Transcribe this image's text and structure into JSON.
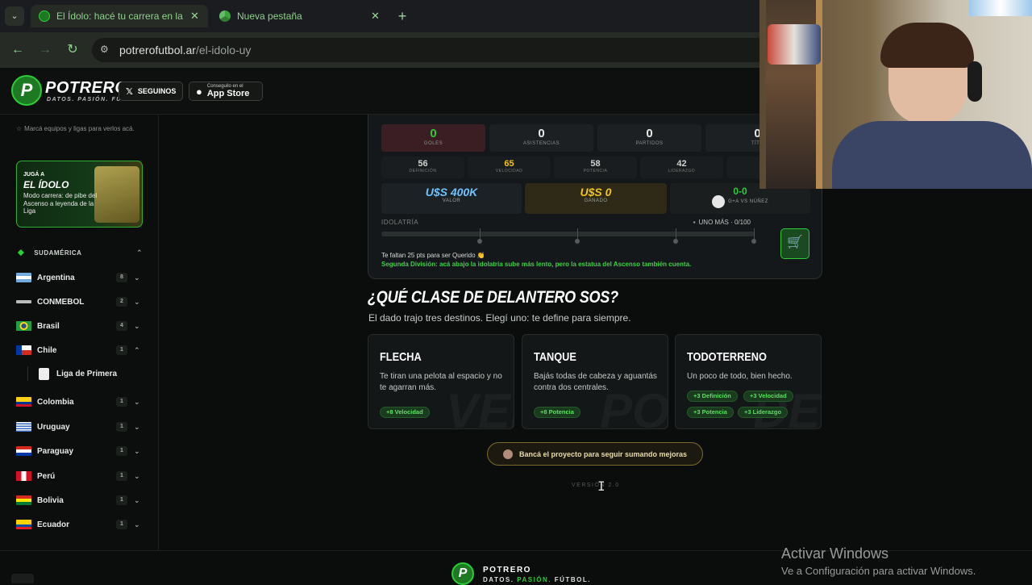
{
  "browser": {
    "tabs": [
      {
        "title": "El Ídolo: hacé tu carrera en la Li"
      },
      {
        "title": "Nueva pestaña"
      }
    ],
    "url_host": "potrerofutbol.ar",
    "url_path": "/el-idolo-uy"
  },
  "header": {
    "logo_letter": "P",
    "logo_name": "POTRERO",
    "logo_tagline": "DATOS. PASIÓN. FÚTBOL.",
    "follow_label": "SEGUINOS",
    "appstore_small": "Conseguilo en el",
    "appstore_label": "App Store"
  },
  "sidebar": {
    "hint": "Marcá equipos y ligas para verlos acá.",
    "promo": {
      "line1": "JUGÁ A",
      "line2": "EL ÍDOLO",
      "line3": "Modo carrera: de pibe del Ascenso a leyenda de la Liga"
    },
    "region": "SUDAMÉRICA",
    "countries": [
      {
        "name": "Argentina",
        "count": "8"
      },
      {
        "name": "CONMEBOL",
        "count": "2"
      },
      {
        "name": "Brasil",
        "count": "4"
      },
      {
        "name": "Chile",
        "count": "1"
      },
      {
        "name": "Colombia",
        "count": "1"
      },
      {
        "name": "Uruguay",
        "count": "1"
      },
      {
        "name": "Paraguay",
        "count": "1"
      },
      {
        "name": "Perú",
        "count": "1"
      },
      {
        "name": "Bolivia",
        "count": "1"
      },
      {
        "name": "Ecuador",
        "count": "1"
      }
    ],
    "league": "Liga de Primera"
  },
  "panel": {
    "stats": [
      {
        "value": "0",
        "label": "GOLES"
      },
      {
        "value": "0",
        "label": "ASISTENCIAS"
      },
      {
        "value": "0",
        "label": "PARTIDOS"
      },
      {
        "value": "0",
        "label": "TÍTU"
      }
    ],
    "attrs": [
      {
        "value": "56",
        "label": "DEFINICIÓN"
      },
      {
        "value": "65",
        "label": "VELOCIDAD"
      },
      {
        "value": "58",
        "label": "POTENCIA"
      },
      {
        "value": "42",
        "label": "LIDERAZGO"
      }
    ],
    "money": [
      {
        "value": "U$S 400K",
        "label": "VALOR"
      },
      {
        "value": "U$S 0",
        "label": "GANADO"
      },
      {
        "value": "0-0",
        "label": "G+A VS NÚÑEZ"
      }
    ],
    "idolatria_label": "IDOLATRÍA",
    "idolatria_right": "UNO MÁS · 0/100",
    "idolatria_progress": 0,
    "msg1": "Te faltan 25 pts para ser Querido 👏",
    "msg2": "Segunda División: acá abajo la idolatría sube más lento, pero la estatua del Ascenso también cuenta."
  },
  "question": {
    "title": "¿QUÉ CLASE DE DELANTERO SOS?",
    "subtitle": "El dado trajo tres destinos. Elegí uno: te define para siempre."
  },
  "options": [
    {
      "title": "FLECHA",
      "desc": "Te tiran una pelota al espacio y no te agarran más.",
      "watermark": "VEL",
      "bonuses": [
        "+8 Velocidad"
      ]
    },
    {
      "title": "TANQUE",
      "desc": "Bajás todas de cabeza y aguantás contra dos centrales.",
      "watermark": "POT",
      "bonuses": [
        "+8 Potencia"
      ]
    },
    {
      "title": "TODOTERRENO",
      "desc": "Un poco de todo, bien hecho.",
      "watermark": "DEF",
      "bonuses": [
        "+3 Definición",
        "+3 Velocidad",
        "+3 Potencia",
        "+3 Liderazgo"
      ]
    }
  ],
  "support_label": "Bancá el proyecto para seguir sumando mejoras",
  "version": "VERSIÓN 2.0",
  "footer": {
    "name": "POTRERO",
    "sub_a": "DATOS.",
    "sub_b": "PASIÓN.",
    "sub_c": "FÚTBOL."
  },
  "windows": {
    "line1": "Activar Windows",
    "line2": "Ve a Configuración para activar Windows."
  },
  "colors": {
    "accent": "#2ccc38",
    "gold": "#f0c419",
    "value_blue": "#6ec3ff"
  }
}
